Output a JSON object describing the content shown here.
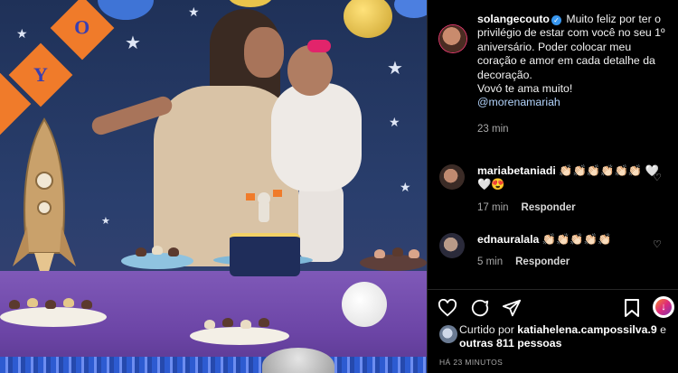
{
  "post": {
    "author": "solangecouto",
    "caption_text": " Muito feliz por ter o privilégio de estar com você no seu 1º aniversário. Poder colocar meu coração e amor em cada detalhe da decoração.",
    "caption_line2": "Vovó te ama muito!",
    "mention": "@morenamariah",
    "time": "23 min"
  },
  "comments": [
    {
      "user": "mariabetaniadi",
      "text": " 👏🏻👏🏻👏🏻👏🏻👏🏻👏🏻 🤍🤍😍",
      "time": "17 min",
      "reply_label": "Responder"
    },
    {
      "user": "ednauralala",
      "text": " 👏🏻👏🏻👏🏻👏🏻👏🏻",
      "time": "5 min",
      "reply_label": "Responder"
    }
  ],
  "likes": {
    "prefix": "Curtido por",
    "user": "katiahelena.campossilva.9",
    "joiner": " e",
    "others": "outras 811 pessoas"
  },
  "timestamp": "HÁ 23 MINUTOS",
  "icons": {
    "like": "heart-icon",
    "comment": "comment-icon",
    "share": "share-icon",
    "save": "bookmark-icon",
    "verified": "verified-badge-icon"
  },
  "colors": {
    "verified": "#3897f0",
    "mention": "#b3d4fc",
    "backdrop": "#2a3f6e",
    "tablecloth": "#7f59b8"
  },
  "photo": {
    "banner_letters": [
      "Y",
      "O"
    ]
  }
}
